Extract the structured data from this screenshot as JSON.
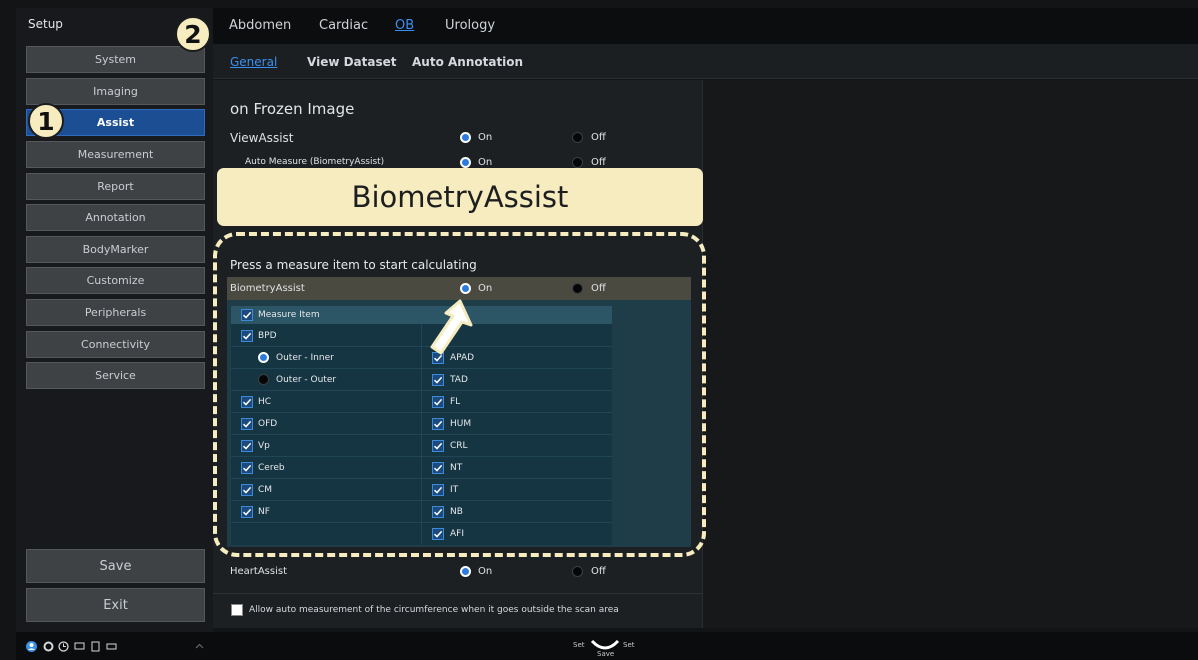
{
  "sidebar": {
    "title": "Setup",
    "items": [
      "System",
      "Imaging",
      "Assist",
      "Measurement",
      "Report",
      "Annotation",
      "BodyMarker",
      "Customize",
      "Peripherals",
      "Connectivity",
      "Service"
    ],
    "active": "Assist",
    "save_label": "Save",
    "exit_label": "Exit"
  },
  "top_tabs": [
    "Abdomen",
    "Cardiac",
    "OB",
    "Urology"
  ],
  "active_top_tab": "OB",
  "sub_tabs": [
    "General",
    "View Dataset",
    "Auto Annotation"
  ],
  "active_sub_tab": "General",
  "section_title": "on Frozen Image",
  "rows": {
    "viewassist": {
      "label": "ViewAssist",
      "on": "On",
      "off": "Off",
      "value": "On"
    },
    "auto_measure": {
      "label": "Auto Measure (BiometryAssist)",
      "on": "On",
      "off": "Off",
      "value": "On"
    },
    "biometryassist": {
      "label": "BiometryAssist",
      "on": "On",
      "off": "Off",
      "value": "On"
    },
    "heartassist": {
      "label": "HeartAssist",
      "on": "On",
      "off": "Off",
      "value": "On"
    }
  },
  "callout": "BiometryAssist",
  "press_text": "Press a measure item to start calculating",
  "measure_header": "Measure Item",
  "measure_left": [
    "BPD",
    "HC",
    "OFD",
    "Vp",
    "Cereb",
    "CM",
    "NF"
  ],
  "bpd_options": [
    "Outer - Inner",
    "Outer - Outer"
  ],
  "bpd_selected": "Outer - Inner",
  "measure_right": [
    "APAD",
    "TAD",
    "FL",
    "HUM",
    "CRL",
    "NT",
    "IT",
    "NB",
    "AFI"
  ],
  "bottom_option": "Allow auto measurement of the circumference when it goes outside the scan area",
  "markers": [
    "1",
    "2"
  ],
  "status": {
    "set": "Set",
    "save": "Save"
  },
  "colors": {
    "accent": "#3a90f0",
    "highlight": "#f6ecbf",
    "active_button": "#1b4e93",
    "grid": "#163542"
  }
}
